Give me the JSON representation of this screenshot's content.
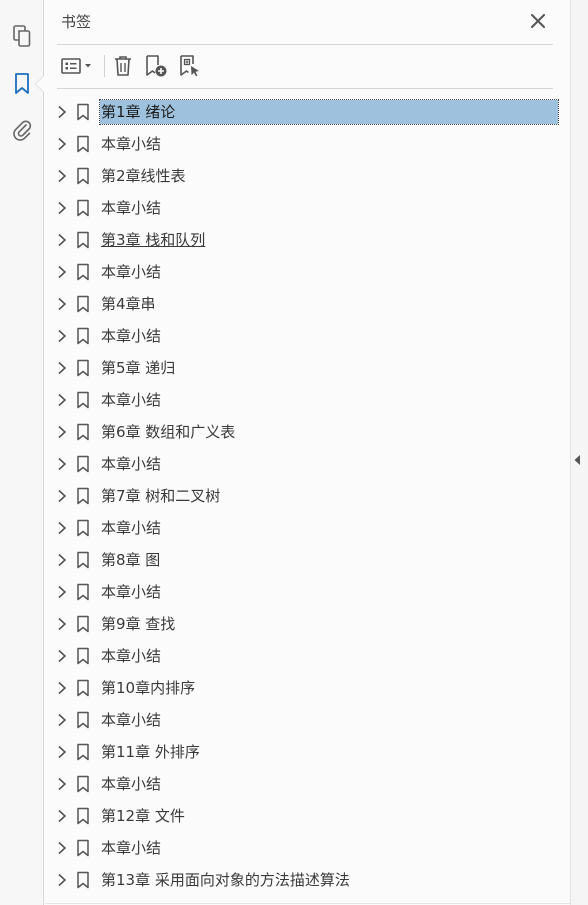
{
  "panel": {
    "title": "书签"
  },
  "left_rail": {
    "buttons": [
      "page-thumbnails",
      "bookmarks",
      "attachments"
    ]
  },
  "toolbar": {
    "buttons": [
      "options-menu",
      "delete-bookmark",
      "new-bookmark",
      "new-bookmark-from-structure"
    ]
  },
  "colors": {
    "accent": "#1e6fc0",
    "selected_bg": "#9ec2de",
    "text": "#3a3a3a"
  },
  "bookmarks": [
    {
      "label": "第1章  绪论",
      "state": "selected"
    },
    {
      "label": "本章小结"
    },
    {
      "label": "第2章线性表"
    },
    {
      "label": "本章小结"
    },
    {
      "label": "第3章  栈和队列",
      "state": "hover"
    },
    {
      "label": "本章小结"
    },
    {
      "label": "第4章串"
    },
    {
      "label": "本章小结"
    },
    {
      "label": "第5章  递归"
    },
    {
      "label": "本章小结"
    },
    {
      "label": "第6章  数组和广义表"
    },
    {
      "label": "本章小结"
    },
    {
      "label": "第7章  树和二叉树"
    },
    {
      "label": "本章小结"
    },
    {
      "label": "第8章  图"
    },
    {
      "label": "本章小结"
    },
    {
      "label": "第9章  查找"
    },
    {
      "label": "本章小结"
    },
    {
      "label": "第10章内排序"
    },
    {
      "label": "本章小结"
    },
    {
      "label": "第11章  外排序"
    },
    {
      "label": "本章小结"
    },
    {
      "label": "第12章  文件"
    },
    {
      "label": "本章小结"
    },
    {
      "label": "第13章  采用面向对象的方法描述算法"
    }
  ]
}
